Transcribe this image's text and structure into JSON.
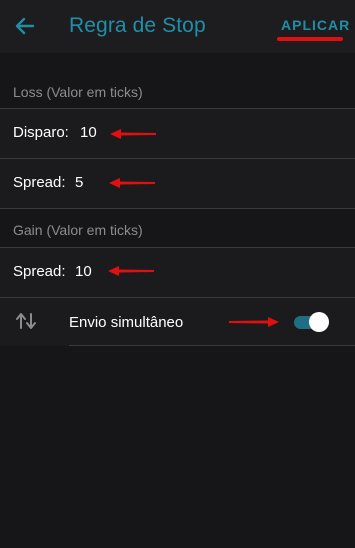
{
  "header": {
    "back_icon": "arrow-left-icon",
    "title": "Regra de Stop",
    "apply_label": "APLICAR"
  },
  "loss_section": {
    "label": "Loss (Valor em ticks)",
    "trigger": {
      "label": "Disparo:",
      "value": "10"
    },
    "spread": {
      "label": "Spread:",
      "value": "5"
    }
  },
  "gain_section": {
    "label": "Gain (Valor em ticks)",
    "spread": {
      "label": "Spread:",
      "value": "10"
    }
  },
  "simultaneous": {
    "icon": "swap-icon",
    "label": "Envio simultâneo",
    "enabled": true
  },
  "colors": {
    "accent": "#1f8fa8",
    "annotation": "#e11010",
    "background": "#161618"
  }
}
